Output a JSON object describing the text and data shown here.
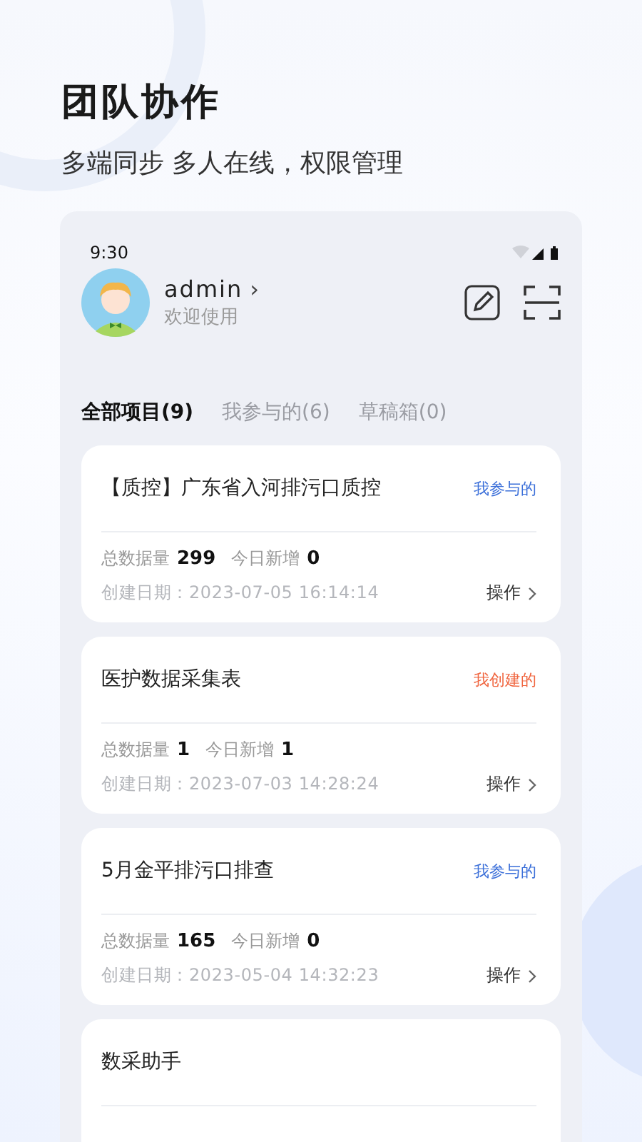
{
  "heading": {
    "title": "团队协作",
    "subtitle": "多端同步 多人在线，权限管理"
  },
  "phone": {
    "status_bar": {
      "time": "9:30"
    },
    "user": {
      "name": "admin",
      "chevron": "›",
      "greeting": "欢迎使用"
    },
    "tabs": [
      {
        "label": "全部项目(9)",
        "selected": true
      },
      {
        "label": "我参与的(6)",
        "selected": false
      },
      {
        "label": "草稿箱(0)",
        "selected": false
      }
    ],
    "projects": [
      {
        "title": "【质控】广东省入河排污口质控",
        "tag": "我参与的",
        "color": "#3b6fd9",
        "total_label": "总数据量",
        "total": "299",
        "today_label": "今日新增",
        "today": "0",
        "date": "创建日期：2023-07-05 16:14:14",
        "action": "操作"
      },
      {
        "title": "医护数据采集表",
        "tag": "我创建的",
        "color": "#f0653f",
        "total_label": "总数据量",
        "total": "1",
        "today_label": "今日新增",
        "today": "1",
        "date": "创建日期：2023-07-03 14:28:24",
        "action": "操作"
      },
      {
        "title": "5月金平排污口排查",
        "tag": "我参与的",
        "color": "#3b6fd9",
        "total_label": "总数据量",
        "total": "165",
        "today_label": "今日新增",
        "today": "0",
        "date": "创建日期：2023-05-04 14:32:23",
        "action": "操作"
      },
      {
        "title": "数采助手"
      }
    ]
  }
}
